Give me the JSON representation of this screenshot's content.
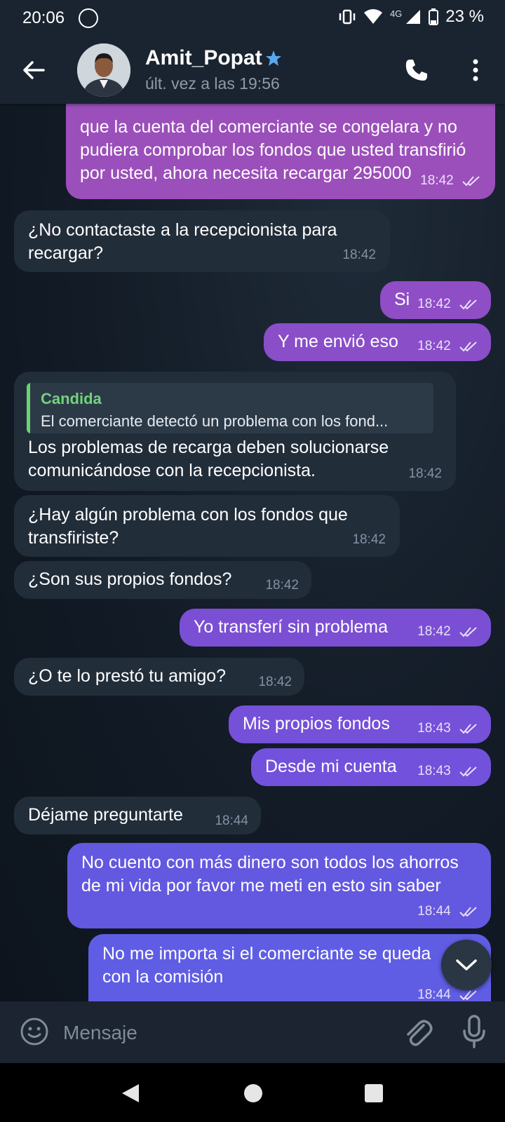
{
  "status_bar": {
    "time": "20:06",
    "network": "4G",
    "battery": "23 %"
  },
  "header": {
    "contact_name": "Amit_Popat",
    "last_seen": "últ. vez a las 19:56"
  },
  "messages": [
    {
      "direction": "out",
      "text": "que la cuenta del comerciante se congelara y no pudiera comprobar los fondos que usted transfirió por usted, ahora necesita recargar 295000",
      "time": "18:42",
      "color": "#9b4fba"
    },
    {
      "direction": "in",
      "text": "¿No contactaste a la recepcionista para recargar?",
      "time": "18:42"
    },
    {
      "direction": "out",
      "text": "Si",
      "time": "18:42",
      "color": "#8f4dc6"
    },
    {
      "direction": "out",
      "text": "Y me envió eso",
      "time": "18:42",
      "color": "#8a4ec9"
    },
    {
      "direction": "in",
      "reply_to": {
        "author": "Candida",
        "text": "El comerciante detectó un problema con los fond..."
      },
      "text": "Los problemas de recarga deben solucionarse comunicándose con la recepcionista.",
      "time": "18:42"
    },
    {
      "direction": "in",
      "text": "¿Hay algún problema con los fondos que transfiriste?",
      "time": "18:42"
    },
    {
      "direction": "in",
      "text": "¿Son sus propios fondos?",
      "time": "18:42"
    },
    {
      "direction": "out",
      "text": "Yo transferí sin problema",
      "time": "18:42",
      "color": "#7b4fd4"
    },
    {
      "direction": "in",
      "text": "¿O te lo prestó tu amigo?",
      "time": "18:42"
    },
    {
      "direction": "out",
      "text": "Mis propios fondos",
      "time": "18:43",
      "color": "#7550d9"
    },
    {
      "direction": "out",
      "text": "Desde mi cuenta",
      "time": "18:43",
      "color": "#7251dc"
    },
    {
      "direction": "in",
      "text": "Déjame preguntarte",
      "time": "18:44"
    },
    {
      "direction": "out",
      "text": "No cuento con más dinero son todos los ahorros de mi vida por favor me meti en esto sin saber",
      "time": "18:44",
      "color": "#6358e0"
    },
    {
      "direction": "out",
      "text": "No me importa si el comerciante se queda con la comisión",
      "time": "18:44",
      "color": "#5f5de4"
    }
  ],
  "composer": {
    "placeholder": "Mensaje"
  },
  "icons": {
    "back": "arrow-left-icon",
    "verified": "star-icon",
    "call": "phone-icon",
    "more": "vertical-dots-icon",
    "scroll_down": "chevron-down-icon",
    "emoji": "smiley-icon",
    "attach": "paperclip-icon",
    "mic": "microphone-icon"
  }
}
